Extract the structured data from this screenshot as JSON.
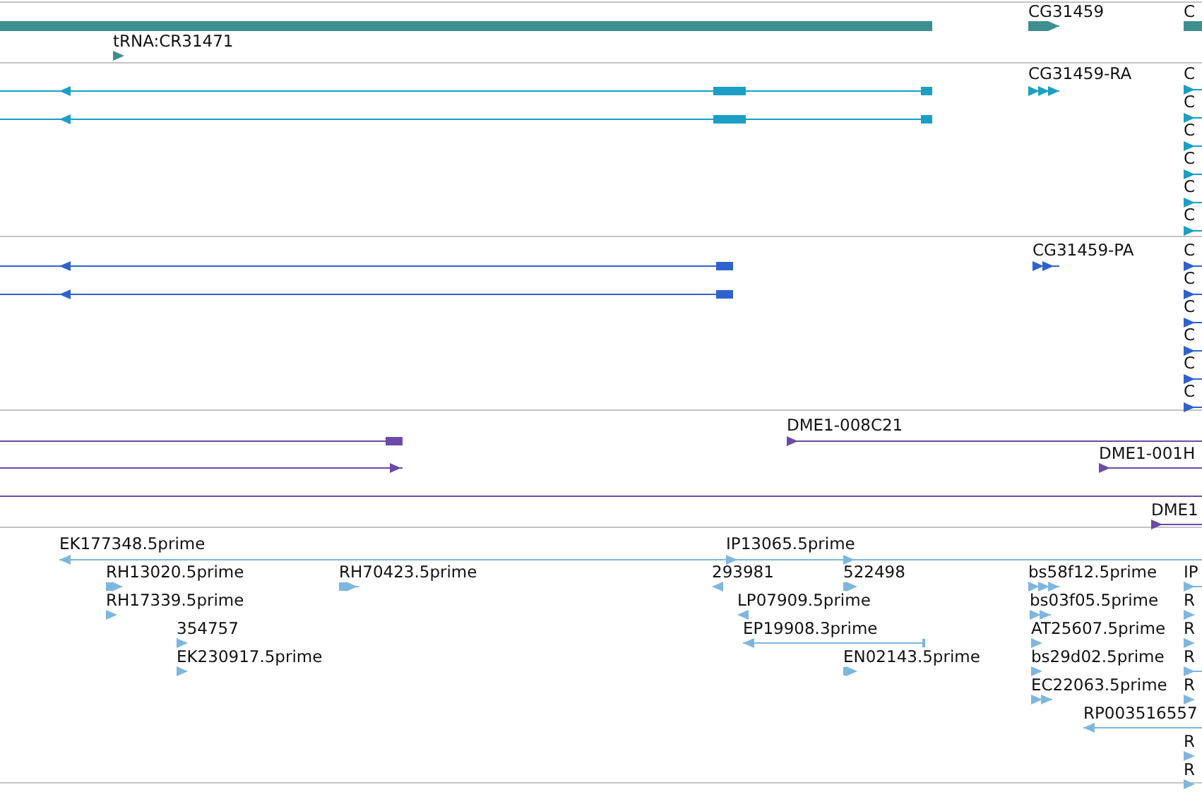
{
  "tracks": [
    {
      "features": [
        {
          "kind": "bar"
        },
        {
          "label": "CG31459",
          "reverse": false,
          "kind": "transcript"
        },
        {
          "label": "C",
          "kind": "bar"
        },
        {
          "label": "tRNA:CR31471",
          "reverse": false,
          "kind": "transcript"
        }
      ]
    },
    {
      "features": [
        {
          "reverse": true,
          "kind": "transcript"
        },
        {
          "reverse": true,
          "kind": "transcript"
        },
        {
          "label": "CG31459-RA",
          "reverse": false,
          "kind": "transcript"
        },
        {
          "label": "C",
          "reverse": false,
          "kind": "transcript"
        },
        {
          "label": "C",
          "reverse": false,
          "kind": "transcript"
        },
        {
          "label": "C",
          "reverse": false,
          "kind": "transcript"
        },
        {
          "label": "C",
          "reverse": false,
          "kind": "transcript"
        },
        {
          "label": "C",
          "reverse": false,
          "kind": "transcript"
        },
        {
          "label": "C",
          "reverse": false,
          "kind": "transcript"
        }
      ]
    },
    {
      "features": [
        {
          "reverse": true,
          "kind": "transcript"
        },
        {
          "reverse": true,
          "kind": "transcript"
        },
        {
          "label": "CG31459-PA",
          "reverse": false,
          "kind": "transcript"
        },
        {
          "label": "C",
          "reverse": false,
          "kind": "transcript"
        },
        {
          "label": "C",
          "reverse": false,
          "kind": "transcript"
        },
        {
          "label": "C",
          "reverse": false,
          "kind": "transcript"
        },
        {
          "label": "C",
          "reverse": false,
          "kind": "transcript"
        },
        {
          "label": "C",
          "reverse": false,
          "kind": "transcript"
        },
        {
          "label": "C",
          "reverse": false,
          "kind": "transcript"
        }
      ]
    },
    {
      "features": [
        {
          "kind": "transcript"
        },
        {
          "reverse": false,
          "kind": "transcript"
        },
        {
          "label": "DME1-008C21",
          "reverse": false,
          "kind": "transcript"
        },
        {
          "label": "DME1-001H",
          "reverse": false,
          "kind": "transcript"
        },
        {
          "kind": "transcript"
        },
        {
          "label": "DME1",
          "reverse": false,
          "kind": "transcript"
        }
      ]
    },
    {
      "features": [
        {
          "label": "EK177348.5prime",
          "reverse": true,
          "kind": "transcript"
        },
        {
          "label": "IP13065.5prime",
          "reverse": false,
          "kind": "transcript"
        },
        {
          "label": "RH13020.5prime",
          "reverse": false,
          "kind": "transcript"
        },
        {
          "label": "RH70423.5prime",
          "reverse": false,
          "kind": "transcript"
        },
        {
          "label": "293981",
          "reverse": true,
          "kind": "transcript"
        },
        {
          "label": "522498",
          "reverse": false,
          "kind": "transcript"
        },
        {
          "label": "bs58f12.5prime",
          "reverse": false,
          "kind": "transcript"
        },
        {
          "label": "IP",
          "reverse": false,
          "kind": "transcript"
        },
        {
          "label": "RH17339.5prime",
          "reverse": false,
          "kind": "transcript"
        },
        {
          "label": "LP07909.5prime",
          "reverse": true,
          "kind": "transcript"
        },
        {
          "label": "bs03f05.5prime",
          "reverse": false,
          "kind": "transcript"
        },
        {
          "label": "R",
          "reverse": false,
          "kind": "transcript"
        },
        {
          "label": "354757",
          "reverse": false,
          "kind": "transcript"
        },
        {
          "label": "EP19908.3prime",
          "reverse": true,
          "kind": "transcript"
        },
        {
          "label": "AT25607.5prime",
          "reverse": false,
          "kind": "transcript"
        },
        {
          "label": "R",
          "reverse": false,
          "kind": "transcript"
        },
        {
          "label": "EK230917.5prime",
          "reverse": false,
          "kind": "transcript"
        },
        {
          "label": "EN02143.5prime",
          "reverse": false,
          "kind": "transcript"
        },
        {
          "label": "bs29d02.5prime",
          "reverse": false,
          "kind": "transcript"
        },
        {
          "label": "R",
          "reverse": false,
          "kind": "transcript"
        },
        {
          "label": "EC22063.5prime",
          "reverse": false,
          "kind": "transcript"
        },
        {
          "label": "R",
          "reverse": false,
          "kind": "transcript"
        },
        {
          "label": "RP003516557",
          "reverse": true,
          "kind": "transcript"
        },
        {
          "label": "R",
          "reverse": false,
          "kind": "transcript"
        },
        {
          "label": "R",
          "reverse": false,
          "kind": "transcript"
        }
      ]
    }
  ]
}
